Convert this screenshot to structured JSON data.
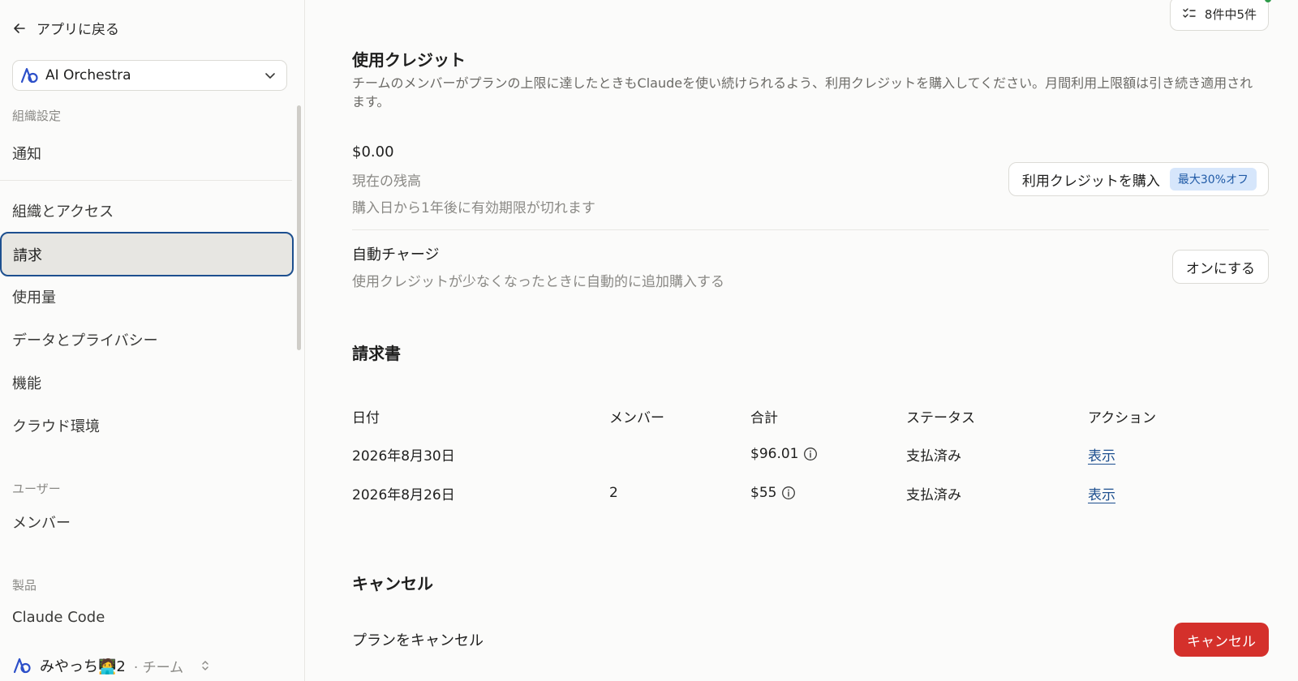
{
  "sidebar": {
    "back_label": "アプリに戻る",
    "org_name": "AI Orchestra",
    "sections": {
      "org_settings": "組織設定",
      "users": "ユーザー",
      "products": "製品"
    },
    "items": {
      "notifications": "通知",
      "org_access": "組織とアクセス",
      "billing": "請求",
      "usage": "使用量",
      "data_privacy": "データとプライバシー",
      "features": "機能",
      "cloud_env": "クラウド環境",
      "members": "メンバー",
      "claude_code": "Claude Code"
    },
    "user": {
      "name": "みやっち🧑‍💻2",
      "team": "· チーム"
    }
  },
  "header": {
    "progress_label": "8件中5件"
  },
  "credits": {
    "title": "使用クレジット",
    "description": "チームのメンバーがプランの上限に達したときもClaudeを使い続けられるよう、利用クレジットを購入してください。月間利用上限額は引き続き適用されます。",
    "balance": "$0.00",
    "balance_label": "現在の残高",
    "expiry_note": "購入日から1年後に有効期限が切れます",
    "buy_label": "利用クレジットを購入",
    "buy_badge": "最大30%オフ",
    "auto_title": "自動チャージ",
    "auto_desc": "使用クレジットが少なくなったときに自動的に追加購入する",
    "auto_button": "オンにする"
  },
  "invoices": {
    "title": "請求書",
    "headers": [
      "日付",
      "メンバー",
      "合計",
      "ステータス",
      "アクション"
    ],
    "rows": [
      {
        "date": "2026年8月30日",
        "members": "",
        "total": "$96.01",
        "status": "支払済み",
        "action": "表示"
      },
      {
        "date": "2026年8月26日",
        "members": "2",
        "total": "$55",
        "status": "支払済み",
        "action": "表示"
      }
    ]
  },
  "cancel": {
    "title": "キャンセル",
    "label": "プランをキャンセル",
    "button": "キャンセル"
  },
  "colors": {
    "accent": "#1d4f8f",
    "danger": "#d4302b",
    "badge_bg": "#d6e6fb"
  }
}
